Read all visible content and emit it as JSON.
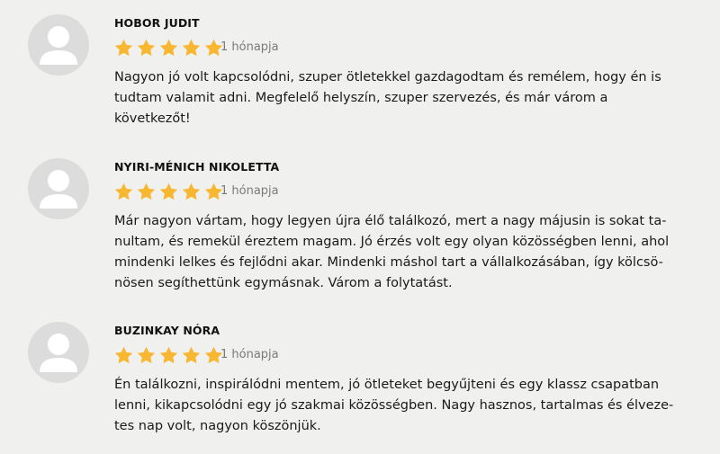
{
  "reviews": [
    {
      "name": "HOBOR JUDIT",
      "rating": 5,
      "time": "1 hónapja",
      "avatar_icon": "user-silhouette-icon",
      "lines": [
        "Nagyon jó volt kapcsolódni, szuper ötletekkel gazdagodtam és remélem, hogy én is",
        "tudtam valamit adni. Megfelelő helyszín, szuper szervezés, és már várom a",
        "következőt!"
      ]
    },
    {
      "name": "NYIRI-MÉNICH NIKOLETTA",
      "rating": 5,
      "time": "1 hónapja",
      "avatar_icon": "user-silhouette-icon",
      "lines": [
        "Már nagyon vártam, hogy legyen újra élő találkozó, mert a nagy májusin is sokat ta-",
        "nultam, és remekül éreztem magam. Jó érzés volt egy olyan közösségben lenni, ahol",
        "mindenki lelkes és fejlődni akar. Mindenki máshol tart a vállalkozásában, így kölcsö-",
        "nösen segíthettünk egymásnak. Várom a folytatást."
      ]
    },
    {
      "name": "BUZINKAY NÓRA",
      "rating": 5,
      "time": "1 hónapja",
      "avatar_icon": "user-silhouette-icon",
      "lines": [
        "Én találkozni, inspirálódni mentem, jó ötleteket begyűjteni és egy klassz csapatban",
        "lenni, kikapcsolódni egy jó szakmai közösségben. Nagy hasznos, tartalmas és élveze-",
        "tes nap volt, nagyon köszönjük."
      ]
    }
  ],
  "colors": {
    "background": "#f0f0ef",
    "star": "#f7b731",
    "avatar_bg": "#dcdcdc",
    "avatar_fg": "#ffffff",
    "time_text": "#7a7a7a"
  }
}
